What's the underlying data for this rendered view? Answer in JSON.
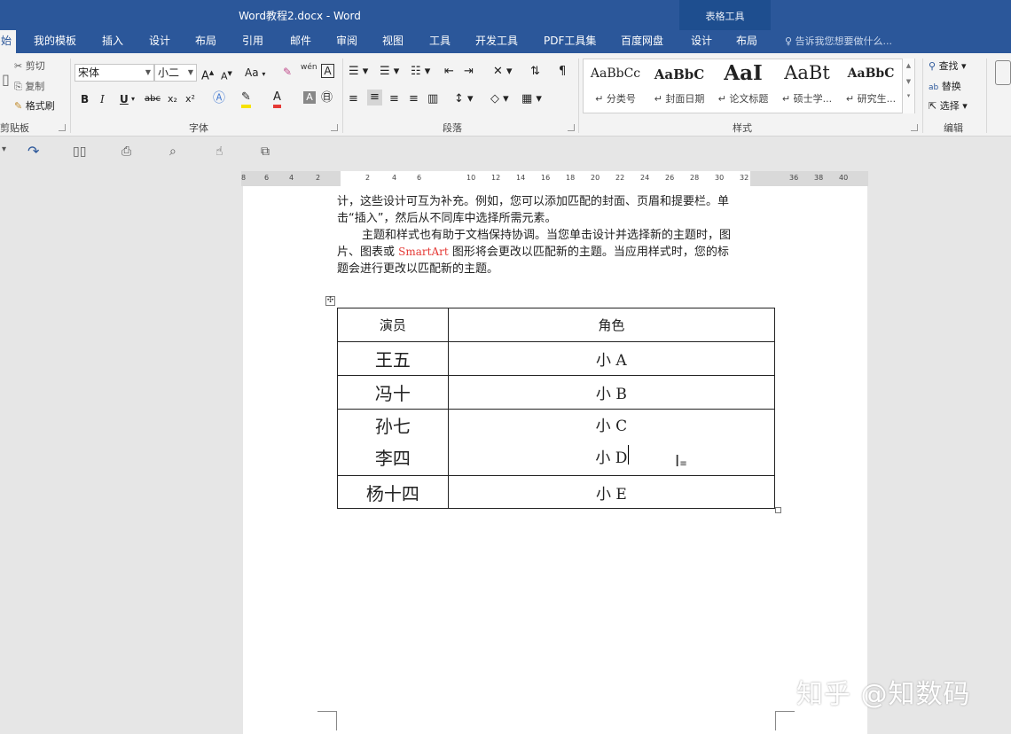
{
  "window": {
    "title": "Word教程2.docx - Word",
    "context_group": "表格工具"
  },
  "tabs": [
    {
      "label": "始",
      "active": true
    },
    {
      "label": "我的模板"
    },
    {
      "label": "插入"
    },
    {
      "label": "设计"
    },
    {
      "label": "布局"
    },
    {
      "label": "引用"
    },
    {
      "label": "邮件"
    },
    {
      "label": "审阅"
    },
    {
      "label": "视图"
    },
    {
      "label": "工具"
    },
    {
      "label": "开发工具"
    },
    {
      "label": "PDF工具集"
    },
    {
      "label": "百度网盘"
    },
    {
      "label": "设计"
    },
    {
      "label": "布局"
    }
  ],
  "tell_me": "告诉我您想要做什么...",
  "clipboard": {
    "cut": "剪切",
    "copy": "复制",
    "format_painter": "格式刷",
    "label": "剪贴板"
  },
  "font": {
    "name": "宋体",
    "size": "小二",
    "label": "字体",
    "grow": "A",
    "shrink": "A",
    "case": "Aa",
    "bold": "B",
    "italic": "I",
    "underline": "U",
    "strike": "abc",
    "sub": "x₂",
    "sup": "x²",
    "pinyin": "wén",
    "border_char": "A"
  },
  "paragraph": {
    "label": "段落"
  },
  "styles": {
    "label": "样式",
    "items": [
      {
        "sample": "AaBbCc",
        "name": "分类号"
      },
      {
        "sample": "AaBbC",
        "name": "封面日期"
      },
      {
        "sample": "AaI",
        "name": "论文标题"
      },
      {
        "sample": "AaBt",
        "name": "硕士学..."
      },
      {
        "sample": "AaBbC",
        "name": "研究生..."
      }
    ]
  },
  "editing": {
    "label": "编辑",
    "find": "查找",
    "replace": "替换",
    "select": "选择"
  },
  "ruler": {
    "marks": [
      "8",
      "6",
      "4",
      "2",
      "2",
      "4",
      "6",
      "10",
      "12",
      "14",
      "16",
      "18",
      "20",
      "22",
      "24",
      "26",
      "28",
      "30",
      "32",
      "36",
      "38",
      "40"
    ]
  },
  "document": {
    "paragraphs": [
      "计，这些设计可互为补充。例如，您可以添加匹配的封面、页眉和提要栏。单",
      "击“插入”，然后从不同库中选择所需元素。",
      "主题和样式也有助于文档保持协调。当您单击设计并选择新的主题时，图"
    ],
    "para4_pre": "片、图表或 ",
    "para4_red": "SmartArt",
    "para4_post": " 图形将会更改以匹配新的主题。当应用样式时，您的标",
    "para5": "题会进行更改以匹配新的主题。",
    "table": {
      "headers": [
        "演员",
        "角色"
      ],
      "rows": [
        {
          "actor": "王五",
          "role": "小 A"
        },
        {
          "actor": "冯十",
          "role": "小 B"
        },
        {
          "actor": "孙七",
          "role": "小 C"
        },
        {
          "actor": "李四",
          "role": "小 D"
        },
        {
          "actor": "杨十四",
          "role": "小 E"
        }
      ]
    }
  },
  "watermark": "知乎 @知数码"
}
